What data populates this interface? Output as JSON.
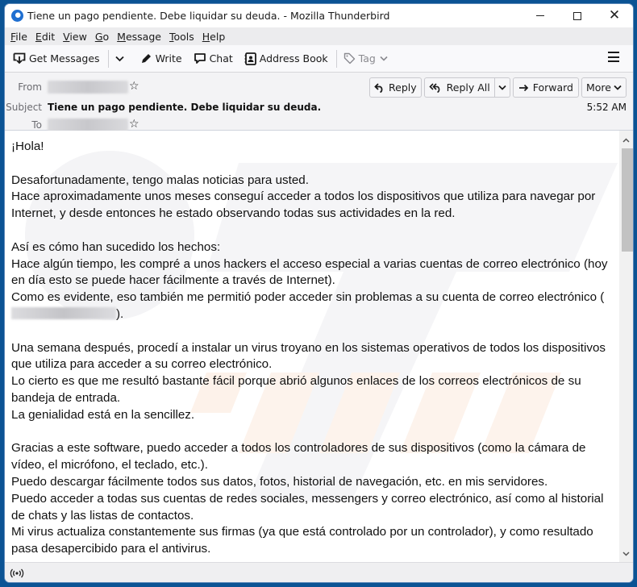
{
  "window": {
    "title": "Tiene un pago pendiente. Debe liquidar su deuda. - Mozilla Thunderbird",
    "controls": {
      "minimize": "minimize-icon",
      "maximize": "maximize-icon",
      "close": "close-icon"
    }
  },
  "menubar": {
    "items": [
      {
        "label": "File",
        "accel": "F"
      },
      {
        "label": "Edit",
        "accel": "E"
      },
      {
        "label": "View",
        "accel": "V"
      },
      {
        "label": "Go",
        "accel": "G"
      },
      {
        "label": "Message",
        "accel": "M"
      },
      {
        "label": "Tools",
        "accel": "T"
      },
      {
        "label": "Help",
        "accel": "H"
      }
    ]
  },
  "toolbar": {
    "get_messages": "Get Messages",
    "write": "Write",
    "chat": "Chat",
    "address_book": "Address Book",
    "tag": "Tag"
  },
  "header": {
    "from_label": "From",
    "subject_label": "Subject",
    "to_label": "To",
    "subject": "Tiene un pago pendiente. Debe liquidar su deuda.",
    "time": "5:52 AM",
    "buttons": {
      "reply": "Reply",
      "reply_all": "Reply All",
      "forward": "Forward",
      "more": "More"
    }
  },
  "message": {
    "paragraphs": [
      [
        "¡Hola!"
      ],
      [
        "Desafortunadamente, tengo malas noticias para usted.",
        "Hace aproximadamente unos meses conseguí acceder a todos los dispositivos que utiliza para navegar por Internet, y desde entonces he estado observando todas sus actividades en la red."
      ],
      [
        "Así es cómo han sucedido los hechos:",
        "Hace algún tiempo, les compré a unos hackers el acceso especial a varias cuentas de correo electrónico (hoy en día esto se puede hacer fácilmente a través de Internet).",
        "Como es evidente, eso también me permitió poder acceder sin problemas a su cuenta de correo electrónico ("
      ],
      [
        "Una semana después, procedí a instalar un virus troyano en los sistemas operativos de todos los dispositivos que utiliza para acceder a su correo electrónico.",
        "Lo cierto es que me resultó bastante fácil porque abrió algunos enlaces de los correos electrónicos de su bandeja de entrada.",
        "La genialidad está en la sencillez."
      ],
      [
        "Gracias a este software, puedo acceder a todos los controladores de sus dispositivos (como la cámara de vídeo, el micrófono, el teclado, etc.).",
        "Puedo descargar fácilmente todos sus datos, fotos, historial de navegación, etc. en mis servidores.",
        "Puedo acceder a todas sus cuentas de redes sociales, messengers y correo electrónico, así como al historial de chats y las listas de contactos.",
        "Mi virus actualiza constantemente sus firmas (ya que está controlado por un controlador), y como resultado pasa desapercibido para el antivirus."
      ]
    ],
    "email_close": ")."
  },
  "statusbar": {
    "icon": "online-status-icon"
  }
}
